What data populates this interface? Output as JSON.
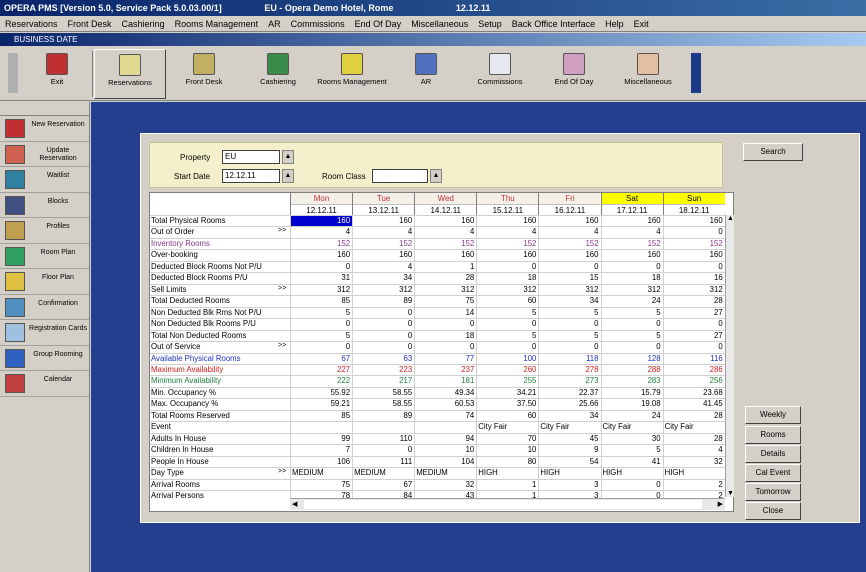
{
  "window": {
    "title": "OPERA PMS [Version 5.0, Service Pack 5.0.03.00/1]",
    "title_center": "EU - Opera Demo Hotel, Rome",
    "title_date": "12.12.11",
    "subtitle": "BUSINESS DATE"
  },
  "menu": [
    "Reservations",
    "Front Desk",
    "Cashiering",
    "Rooms Management",
    "AR",
    "Commissions",
    "End Of Day",
    "Miscellaneous",
    "Setup",
    "Back Office Interface",
    "Help",
    "Exit"
  ],
  "toolbar": {
    "exit": "Exit",
    "reservations": "Reservations",
    "front_desk": "Front Desk",
    "cashiering": "Cashiering",
    "rooms_management": "Rooms Management",
    "ar": "AR",
    "commissions": "Commissions",
    "end_of_day": "End Of Day",
    "miscellaneous": "Miscellaneous"
  },
  "sidebar": [
    {
      "label": "New Reservation",
      "icon": "new-reservation-icon"
    },
    {
      "label": "Update Reservation",
      "icon": "update-reservation-icon"
    },
    {
      "label": "Waitlist",
      "icon": "waitlist-icon"
    },
    {
      "label": "Blocks",
      "icon": "blocks-icon"
    },
    {
      "label": "Profiles",
      "icon": "profiles-icon"
    },
    {
      "label": "Room Plan",
      "icon": "room-plan-icon"
    },
    {
      "label": "Floor Plan",
      "icon": "floor-plan-icon"
    },
    {
      "label": "Confirmation",
      "icon": "confirmation-icon"
    },
    {
      "label": "Registration Cards",
      "icon": "registration-cards-icon"
    },
    {
      "label": "Group Rooming",
      "icon": "group-rooming-icon"
    },
    {
      "label": "Calendar",
      "icon": "calendar-icon"
    }
  ],
  "filter": {
    "property_label": "Property",
    "property_value": "EU",
    "start_date_label": "Start Date",
    "start_date_value": "12.12.11",
    "room_class_label": "Room Class",
    "room_class_value": ""
  },
  "buttons": {
    "search": "Search",
    "weekly": "Weekly",
    "rooms": "Rooms",
    "details": "Details",
    "cal_event": "Cal Event",
    "tomorrow": "Tomorrow",
    "close": "Close"
  },
  "days": [
    {
      "day": "Mon",
      "date": "12.12.11"
    },
    {
      "day": "Tue",
      "date": "13.12.11"
    },
    {
      "day": "Wed",
      "date": "14.12.11"
    },
    {
      "day": "Thu",
      "date": "15.12.11"
    },
    {
      "day": "Fri",
      "date": "16.12.11"
    },
    {
      "day": "Sat",
      "date": "17.12.11"
    },
    {
      "day": "Sun",
      "date": "18.12.11"
    }
  ],
  "colors": {
    "weekday_header": "#c0303a",
    "weekend_header_bg": "#ffff00",
    "selected_cell_bg": "#0000cc",
    "workspace_bg": "#253f8e",
    "filter_bg": "#f4f0cc"
  },
  "rows": [
    {
      "label": "Total Physical Rooms",
      "values": [
        "160",
        "160",
        "160",
        "160",
        "160",
        "160",
        "160"
      ]
    },
    {
      "label": "Out of Order",
      "expand": true,
      "values": [
        "4",
        "4",
        "4",
        "4",
        "4",
        "4",
        "0"
      ]
    },
    {
      "label": "Inventory Rooms",
      "color": "#8b3a8b",
      "values": [
        "152",
        "152",
        "152",
        "152",
        "152",
        "152",
        "152"
      ]
    },
    {
      "label": "Over-booking",
      "values": [
        "160",
        "160",
        "160",
        "160",
        "160",
        "160",
        "160"
      ]
    },
    {
      "label": "Deducted Block Rooms Not P/U",
      "values": [
        "0",
        "4",
        "1",
        "0",
        "0",
        "0",
        "0"
      ]
    },
    {
      "label": "Deducted Block Rooms P/U",
      "values": [
        "31",
        "34",
        "28",
        "18",
        "15",
        "18",
        "16"
      ]
    },
    {
      "label": "Sell Limits",
      "expand": true,
      "values": [
        "312",
        "312",
        "312",
        "312",
        "312",
        "312",
        "312"
      ]
    },
    {
      "label": "Total Deducted Rooms",
      "values": [
        "85",
        "89",
        "75",
        "60",
        "34",
        "24",
        "28"
      ]
    },
    {
      "label": "Non Deducted Blk Rms Not P/U",
      "values": [
        "5",
        "0",
        "14",
        "5",
        "5",
        "5",
        "27"
      ]
    },
    {
      "label": "Non Deducted Blk Rooms P/U",
      "values": [
        "0",
        "0",
        "0",
        "0",
        "0",
        "0",
        "0"
      ]
    },
    {
      "label": "Total Non Deducted Rooms",
      "values": [
        "5",
        "0",
        "18",
        "5",
        "5",
        "5",
        "27"
      ]
    },
    {
      "label": "Out of Service",
      "expand": true,
      "values": [
        "0",
        "0",
        "0",
        "0",
        "0",
        "0",
        "0"
      ]
    },
    {
      "label": "Available Physical Rooms",
      "color": "#2030c0",
      "values": [
        "67",
        "63",
        "77",
        "100",
        "118",
        "128",
        "116"
      ]
    },
    {
      "label": "Maximum Availability",
      "color": "#d02020",
      "values": [
        "227",
        "223",
        "237",
        "260",
        "278",
        "288",
        "286"
      ]
    },
    {
      "label": "Minimum Availability",
      "color": "#208040",
      "values": [
        "222",
        "217",
        "181",
        "255",
        "273",
        "283",
        "256"
      ]
    },
    {
      "label": "Min. Occupancy %",
      "values": [
        "55.92",
        "58.55",
        "49.34",
        "34.21",
        "22.37",
        "15.79",
        "23.68"
      ]
    },
    {
      "label": "Max. Occupancy %",
      "values": [
        "59.21",
        "58.55",
        "60.53",
        "37.50",
        "25.66",
        "19.08",
        "41.45"
      ]
    },
    {
      "label": "Total Rooms Reserved",
      "values": [
        "85",
        "89",
        "74",
        "60",
        "34",
        "24",
        "28"
      ]
    },
    {
      "label": "Event",
      "values": [
        "",
        "",
        "",
        "City Fair",
        "City Fair",
        "City Fair",
        "City Fair"
      ],
      "text": true
    },
    {
      "label": "Adults In House",
      "values": [
        "99",
        "110",
        "94",
        "70",
        "45",
        "30",
        "28"
      ]
    },
    {
      "label": "Children In House",
      "values": [
        "7",
        "0",
        "10",
        "10",
        "9",
        "5",
        "4"
      ]
    },
    {
      "label": "People In House",
      "values": [
        "106",
        "111",
        "104",
        "80",
        "54",
        "41",
        "32"
      ]
    },
    {
      "label": "Day Type",
      "expand": true,
      "values": [
        "MEDIUM",
        "MEDIUM",
        "MEDIUM",
        "HIGH",
        "HIGH",
        "HIGH",
        "HIGH"
      ],
      "text": true
    },
    {
      "label": "Arrival Rooms",
      "values": [
        "75",
        "67",
        "32",
        "1",
        "3",
        "0",
        "2"
      ]
    },
    {
      "label": "Arrival Persons",
      "values": [
        "78",
        "84",
        "43",
        "1",
        "3",
        "0",
        "2"
      ]
    }
  ]
}
